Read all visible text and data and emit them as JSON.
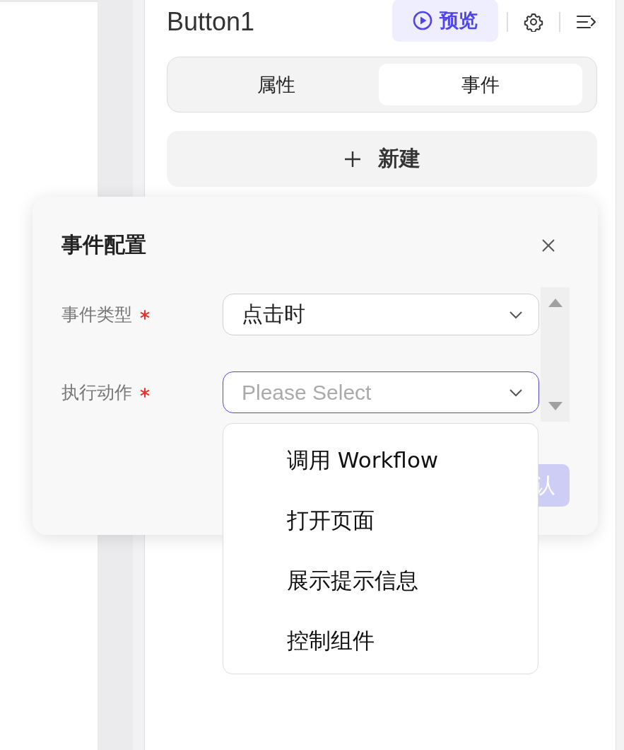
{
  "header": {
    "title": "Button1",
    "preview_button": "预览"
  },
  "tabs": [
    {
      "label": "属性",
      "selected": false
    },
    {
      "label": "事件",
      "selected": true
    }
  ],
  "new_button": {
    "label": "新建"
  },
  "dialog": {
    "title": "事件配置",
    "fields": [
      {
        "label": "事件类型",
        "required": true,
        "value": "点击时",
        "focused": false
      },
      {
        "label": "执行动作",
        "required": true,
        "placeholder": "Please Select",
        "focused": true
      }
    ],
    "confirm_button": "认"
  },
  "dropdown": {
    "options": [
      {
        "label": "调用 Workflow"
      },
      {
        "label": "打开页面"
      },
      {
        "label": "展示提示信息"
      },
      {
        "label": "控制组件"
      }
    ]
  }
}
